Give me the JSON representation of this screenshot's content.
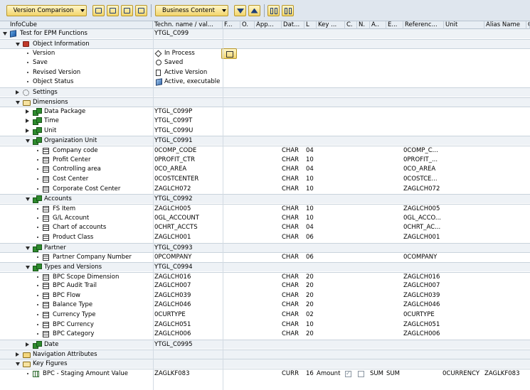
{
  "toolbar": {
    "version_comparison": "Version Comparison",
    "business_content": "Business Content"
  },
  "columns": [
    "InfoCube",
    "Techn. name / val...",
    "F...",
    "O.",
    "App...",
    "Dat...",
    "L",
    "Key ...",
    "C.",
    "N.",
    "A..",
    "E...",
    "Referenc...",
    "Unit",
    "Alias Name",
    "C"
  ],
  "rows": [
    {
      "label": "Test for EPM Functions",
      "tech": "YTGL_C099",
      "level": 0,
      "twisty": "exp",
      "icon": "cube",
      "shade": true
    },
    {
      "label": "Object Information",
      "tech": "",
      "level": 1,
      "twisty": "exp",
      "icon": "objinfo",
      "shade": true
    },
    {
      "label": "Version",
      "tech": "In Process",
      "level": 2,
      "twisty": "dot",
      "icon": "none",
      "valicon": "diamond",
      "button": true
    },
    {
      "label": "Save",
      "tech": "Saved",
      "level": 2,
      "twisty": "dot",
      "icon": "none",
      "valicon": "plus"
    },
    {
      "label": "Revised Version",
      "tech": "Active Version",
      "level": 2,
      "twisty": "dot",
      "icon": "none",
      "valicon": "doc"
    },
    {
      "label": "Object Status",
      "tech": "Active, executable",
      "level": 2,
      "twisty": "dot",
      "icon": "none",
      "valicon": "cubeexe"
    },
    {
      "label": "Settings",
      "tech": "",
      "level": 1,
      "twisty": "col",
      "icon": "settings",
      "shade": true
    },
    {
      "label": "Dimensions",
      "tech": "",
      "level": 1,
      "twisty": "exp",
      "icon": "folder-open",
      "shade": true
    },
    {
      "label": "Data Package",
      "tech": "YTGL_C099P",
      "level": 2,
      "twisty": "col",
      "icon": "dim"
    },
    {
      "label": "Time",
      "tech": "YTGL_C099T",
      "level": 2,
      "twisty": "col",
      "icon": "dim"
    },
    {
      "label": "Unit",
      "tech": "YTGL_C099U",
      "level": 2,
      "twisty": "col",
      "icon": "dim"
    },
    {
      "label": "Organization Unit",
      "tech": "YTGL_C0991",
      "level": 2,
      "twisty": "exp",
      "icon": "dim",
      "shade": true
    },
    {
      "label": "Company code",
      "tech": "0COMP_CODE",
      "level": 3,
      "twisty": "dot",
      "icon": "char",
      "dtype": "CHAR",
      "len": "04",
      "ref": "0COMP_C..."
    },
    {
      "label": "Profit Center",
      "tech": "0PROFIT_CTR",
      "level": 3,
      "twisty": "dot",
      "icon": "char",
      "dtype": "CHAR",
      "len": "10",
      "ref": "0PROFIT_..."
    },
    {
      "label": "Controlling area",
      "tech": "0CO_AREA",
      "level": 3,
      "twisty": "dot",
      "icon": "char",
      "dtype": "CHAR",
      "len": "04",
      "ref": "0CO_AREA"
    },
    {
      "label": "Cost Center",
      "tech": "0COSTCENTER",
      "level": 3,
      "twisty": "dot",
      "icon": "char",
      "dtype": "CHAR",
      "len": "10",
      "ref": "0COSTCE..."
    },
    {
      "label": "Corporate Cost Center",
      "tech": "ZAGLCH072",
      "level": 3,
      "twisty": "dot",
      "icon": "char",
      "dtype": "CHAR",
      "len": "10",
      "ref": "ZAGLCH072"
    },
    {
      "label": "Accounts",
      "tech": "YTGL_C0992",
      "level": 2,
      "twisty": "exp",
      "icon": "dim",
      "shade": true
    },
    {
      "label": "FS Item",
      "tech": "ZAGLCH005",
      "level": 3,
      "twisty": "dot",
      "icon": "char",
      "dtype": "CHAR",
      "len": "10",
      "ref": "ZAGLCH005"
    },
    {
      "label": "G/L Account",
      "tech": "0GL_ACCOUNT",
      "level": 3,
      "twisty": "dot",
      "icon": "char",
      "dtype": "CHAR",
      "len": "10",
      "ref": "0GL_ACCO..."
    },
    {
      "label": "Chart of accounts",
      "tech": "0CHRT_ACCTS",
      "level": 3,
      "twisty": "dot",
      "icon": "char",
      "dtype": "CHAR",
      "len": "04",
      "ref": "0CHRT_AC..."
    },
    {
      "label": "Product Class",
      "tech": "ZAGLCH001",
      "level": 3,
      "twisty": "dot",
      "icon": "char",
      "dtype": "CHAR",
      "len": "06",
      "ref": "ZAGLCH001"
    },
    {
      "label": "Partner",
      "tech": "YTGL_C0993",
      "level": 2,
      "twisty": "exp",
      "icon": "dim",
      "shade": true
    },
    {
      "label": "Partner Company Number",
      "tech": "0PCOMPANY",
      "level": 3,
      "twisty": "dot",
      "icon": "char",
      "dtype": "CHAR",
      "len": "06",
      "ref": "0COMPANY"
    },
    {
      "label": "Types and Versions",
      "tech": "YTGL_C0994",
      "level": 2,
      "twisty": "exp",
      "icon": "dim",
      "shade": true
    },
    {
      "label": "BPC Scope Dimension",
      "tech": "ZAGLCH016",
      "level": 3,
      "twisty": "dot",
      "icon": "char",
      "dtype": "CHAR",
      "len": "20",
      "ref": "ZAGLCH016"
    },
    {
      "label": "BPC Audit Trail",
      "tech": "ZAGLCH007",
      "level": 3,
      "twisty": "dot",
      "icon": "char",
      "dtype": "CHAR",
      "len": "20",
      "ref": "ZAGLCH007"
    },
    {
      "label": "BPC Flow",
      "tech": "ZAGLCH039",
      "level": 3,
      "twisty": "dot",
      "icon": "char",
      "dtype": "CHAR",
      "len": "20",
      "ref": "ZAGLCH039"
    },
    {
      "label": "Balance Type",
      "tech": "ZAGLCH046",
      "level": 3,
      "twisty": "dot",
      "icon": "char",
      "dtype": "CHAR",
      "len": "20",
      "ref": "ZAGLCH046"
    },
    {
      "label": "Currency Type",
      "tech": "0CURTYPE",
      "level": 3,
      "twisty": "dot",
      "icon": "char",
      "dtype": "CHAR",
      "len": "02",
      "ref": "0CURTYPE"
    },
    {
      "label": "BPC Currency",
      "tech": "ZAGLCH051",
      "level": 3,
      "twisty": "dot",
      "icon": "char",
      "dtype": "CHAR",
      "len": "10",
      "ref": "ZAGLCH051"
    },
    {
      "label": "BPC Category",
      "tech": "ZAGLCH006",
      "level": 3,
      "twisty": "dot",
      "icon": "char",
      "dtype": "CHAR",
      "len": "20",
      "ref": "ZAGLCH006"
    },
    {
      "label": "Date",
      "tech": "YTGL_C0995",
      "level": 2,
      "twisty": "col",
      "icon": "dim",
      "shade": true
    },
    {
      "label": "Navigation Attributes",
      "tech": "",
      "level": 1,
      "twisty": "col",
      "icon": "folder",
      "shade": true
    },
    {
      "label": "Key Figures",
      "tech": "",
      "level": 1,
      "twisty": "exp",
      "icon": "folder-open",
      "shade": true
    },
    {
      "label": "BPC - Staging Amount Value",
      "tech": "ZAGLKF083",
      "level": 2,
      "twisty": "dot",
      "icon": "kf",
      "dtype": "CURR",
      "len": "16",
      "keytype": "Amount",
      "chk_c": true,
      "chk_n": false,
      "agg": "SUM",
      "exc": "SUM",
      "unit": "0CURRENCY",
      "alias": "ZAGLKF083"
    }
  ]
}
